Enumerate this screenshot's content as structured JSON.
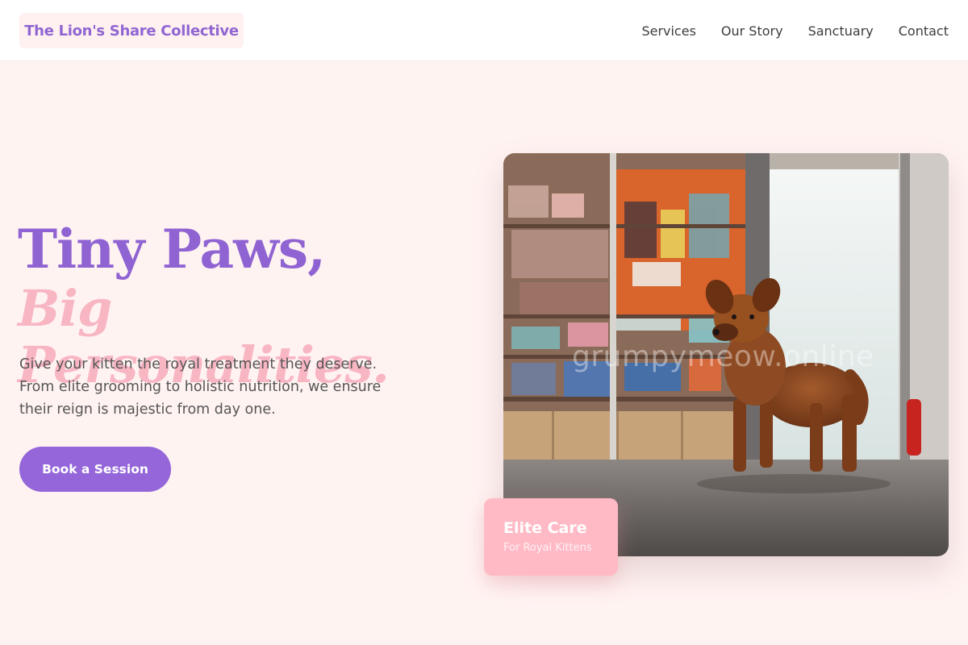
{
  "header": {
    "logo_text": "The Lion's Share Collective",
    "nav": [
      "Services",
      "Our Story",
      "Sanctuary",
      "Contact"
    ]
  },
  "hero": {
    "headline_line1": "Tiny Paws,",
    "headline_line2": "Big Personalities.",
    "subtext": "Give your kitten the royal treatment they deserve. From elite grooming to holistic nutrition, we ensure their reign is majestic from day one.",
    "cta_label": "Book a Session"
  },
  "photo": {
    "subject": "small brown dog standing in a pet shop aisle",
    "watermark": "grumpymeow.online"
  },
  "badge": {
    "title": "Elite Care",
    "subtitle": "For Royal Kittens"
  },
  "colors": {
    "background": "#fff3f2",
    "primary_purple": "#9466d9",
    "accent_pink": "#ffbac5",
    "headline_pink": "#f8b6c3"
  }
}
